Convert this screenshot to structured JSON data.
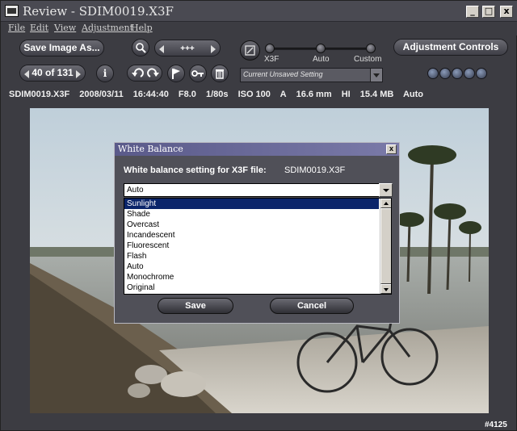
{
  "window": {
    "title": "Review - SDIM0019.X3F",
    "min": "_",
    "max": "□",
    "close": "x"
  },
  "menu": [
    "File",
    "Edit",
    "View",
    "Adjustment",
    "Help"
  ],
  "toolbar": {
    "save_image_as": "Save Image As...",
    "zoom_value": "+++",
    "image_counter": "40 of 131",
    "adjustment_controls": "Adjustment Controls",
    "info_glyph": "i",
    "presets": {
      "labels": [
        "X3F",
        "Auto",
        "Custom"
      ],
      "current_setting": "Current Unsaved Setting"
    }
  },
  "info_bar": [
    "SDIM0019.X3F",
    "2008/03/11",
    "16:44:40",
    "F8.0",
    "1/80s",
    "ISO 100",
    "A",
    "16.6 mm",
    "HI",
    "15.4 MB",
    "Auto"
  ],
  "dialog": {
    "title": "White Balance",
    "close": "x",
    "prompt": "White balance setting for X3F file:",
    "filename": "SDIM0019.X3F",
    "combo_value": "Auto",
    "options": [
      "Sunlight",
      "Shade",
      "Overcast",
      "Incandescent",
      "Fluorescent",
      "Flash",
      "Auto",
      "Monochrome",
      "Original"
    ],
    "selected_index": 0,
    "save_label": "Save",
    "cancel_label": "Cancel"
  },
  "watermark": "#4125",
  "colors": {
    "window_bg": "#3c3c42",
    "dialog_title": "#6a6a9a",
    "list_selected": "#0a246a"
  }
}
